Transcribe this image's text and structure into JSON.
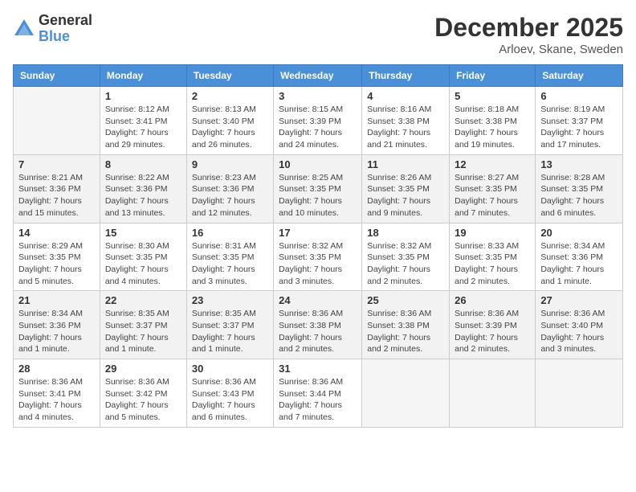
{
  "logo": {
    "general": "General",
    "blue": "Blue"
  },
  "title": "December 2025",
  "location": "Arloev, Skane, Sweden",
  "weekdays": [
    "Sunday",
    "Monday",
    "Tuesday",
    "Wednesday",
    "Thursday",
    "Friday",
    "Saturday"
  ],
  "weeks": [
    [
      {
        "day": "",
        "info": ""
      },
      {
        "day": "1",
        "info": "Sunrise: 8:12 AM\nSunset: 3:41 PM\nDaylight: 7 hours and 29 minutes."
      },
      {
        "day": "2",
        "info": "Sunrise: 8:13 AM\nSunset: 3:40 PM\nDaylight: 7 hours and 26 minutes."
      },
      {
        "day": "3",
        "info": "Sunrise: 8:15 AM\nSunset: 3:39 PM\nDaylight: 7 hours and 24 minutes."
      },
      {
        "day": "4",
        "info": "Sunrise: 8:16 AM\nSunset: 3:38 PM\nDaylight: 7 hours and 21 minutes."
      },
      {
        "day": "5",
        "info": "Sunrise: 8:18 AM\nSunset: 3:38 PM\nDaylight: 7 hours and 19 minutes."
      },
      {
        "day": "6",
        "info": "Sunrise: 8:19 AM\nSunset: 3:37 PM\nDaylight: 7 hours and 17 minutes."
      }
    ],
    [
      {
        "day": "7",
        "info": "Sunrise: 8:21 AM\nSunset: 3:36 PM\nDaylight: 7 hours and 15 minutes."
      },
      {
        "day": "8",
        "info": "Sunrise: 8:22 AM\nSunset: 3:36 PM\nDaylight: 7 hours and 13 minutes."
      },
      {
        "day": "9",
        "info": "Sunrise: 8:23 AM\nSunset: 3:36 PM\nDaylight: 7 hours and 12 minutes."
      },
      {
        "day": "10",
        "info": "Sunrise: 8:25 AM\nSunset: 3:35 PM\nDaylight: 7 hours and 10 minutes."
      },
      {
        "day": "11",
        "info": "Sunrise: 8:26 AM\nSunset: 3:35 PM\nDaylight: 7 hours and 9 minutes."
      },
      {
        "day": "12",
        "info": "Sunrise: 8:27 AM\nSunset: 3:35 PM\nDaylight: 7 hours and 7 minutes."
      },
      {
        "day": "13",
        "info": "Sunrise: 8:28 AM\nSunset: 3:35 PM\nDaylight: 7 hours and 6 minutes."
      }
    ],
    [
      {
        "day": "14",
        "info": "Sunrise: 8:29 AM\nSunset: 3:35 PM\nDaylight: 7 hours and 5 minutes."
      },
      {
        "day": "15",
        "info": "Sunrise: 8:30 AM\nSunset: 3:35 PM\nDaylight: 7 hours and 4 minutes."
      },
      {
        "day": "16",
        "info": "Sunrise: 8:31 AM\nSunset: 3:35 PM\nDaylight: 7 hours and 3 minutes."
      },
      {
        "day": "17",
        "info": "Sunrise: 8:32 AM\nSunset: 3:35 PM\nDaylight: 7 hours and 3 minutes."
      },
      {
        "day": "18",
        "info": "Sunrise: 8:32 AM\nSunset: 3:35 PM\nDaylight: 7 hours and 2 minutes."
      },
      {
        "day": "19",
        "info": "Sunrise: 8:33 AM\nSunset: 3:35 PM\nDaylight: 7 hours and 2 minutes."
      },
      {
        "day": "20",
        "info": "Sunrise: 8:34 AM\nSunset: 3:36 PM\nDaylight: 7 hours and 1 minute."
      }
    ],
    [
      {
        "day": "21",
        "info": "Sunrise: 8:34 AM\nSunset: 3:36 PM\nDaylight: 7 hours and 1 minute."
      },
      {
        "day": "22",
        "info": "Sunrise: 8:35 AM\nSunset: 3:37 PM\nDaylight: 7 hours and 1 minute."
      },
      {
        "day": "23",
        "info": "Sunrise: 8:35 AM\nSunset: 3:37 PM\nDaylight: 7 hours and 1 minute."
      },
      {
        "day": "24",
        "info": "Sunrise: 8:36 AM\nSunset: 3:38 PM\nDaylight: 7 hours and 2 minutes."
      },
      {
        "day": "25",
        "info": "Sunrise: 8:36 AM\nSunset: 3:38 PM\nDaylight: 7 hours and 2 minutes."
      },
      {
        "day": "26",
        "info": "Sunrise: 8:36 AM\nSunset: 3:39 PM\nDaylight: 7 hours and 2 minutes."
      },
      {
        "day": "27",
        "info": "Sunrise: 8:36 AM\nSunset: 3:40 PM\nDaylight: 7 hours and 3 minutes."
      }
    ],
    [
      {
        "day": "28",
        "info": "Sunrise: 8:36 AM\nSunset: 3:41 PM\nDaylight: 7 hours and 4 minutes."
      },
      {
        "day": "29",
        "info": "Sunrise: 8:36 AM\nSunset: 3:42 PM\nDaylight: 7 hours and 5 minutes."
      },
      {
        "day": "30",
        "info": "Sunrise: 8:36 AM\nSunset: 3:43 PM\nDaylight: 7 hours and 6 minutes."
      },
      {
        "day": "31",
        "info": "Sunrise: 8:36 AM\nSunset: 3:44 PM\nDaylight: 7 hours and 7 minutes."
      },
      {
        "day": "",
        "info": ""
      },
      {
        "day": "",
        "info": ""
      },
      {
        "day": "",
        "info": ""
      }
    ]
  ]
}
